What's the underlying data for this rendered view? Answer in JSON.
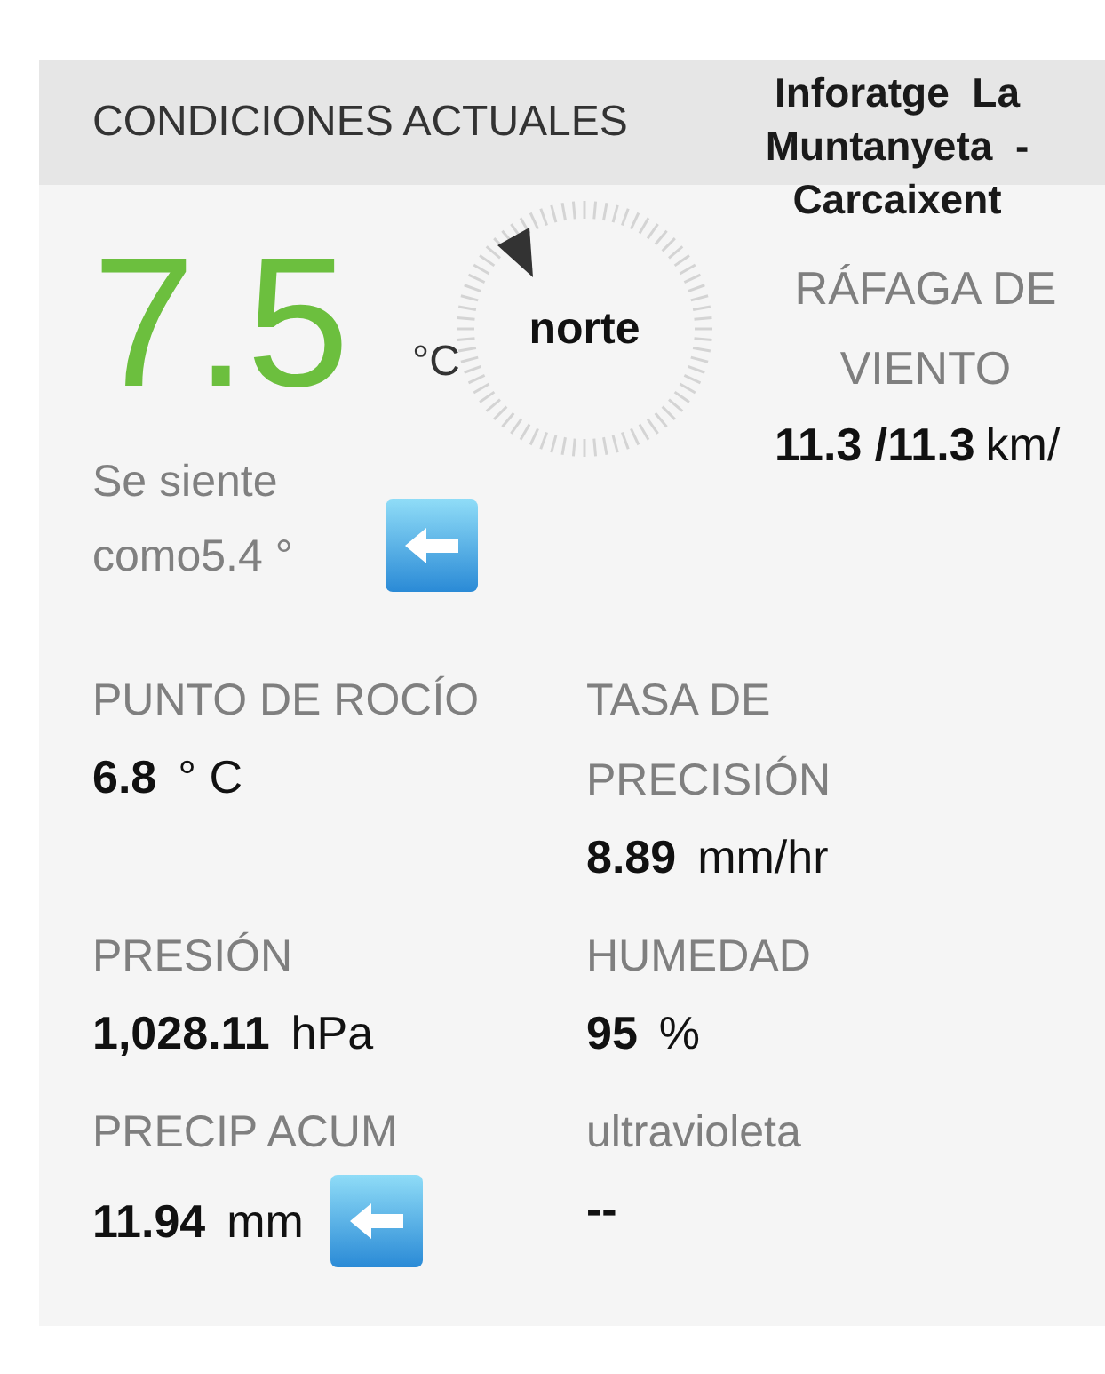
{
  "header": {
    "title": "CONDICIONES ACTUALES",
    "station": "Inforatge  La Muntanyeta  - Carcaixent"
  },
  "temperature": {
    "value": "7.5",
    "unit": "°C",
    "feels_like": "Se siente como5.4 °",
    "trend_arrow": true
  },
  "wind": {
    "direction": "norte",
    "label": "RÁFAGA DE VIENTO",
    "value": "11.3 /11.3",
    "unit": "km/"
  },
  "readings": [
    {
      "label": "PUNTO DE ROCÍO",
      "value": "6.8",
      "unit": "° C"
    },
    {
      "label": "TASA DE PRECISIÓN",
      "value": "8.89",
      "unit": "mm/hr"
    },
    {
      "label": "PRESIÓN",
      "value": "1,028.11",
      "unit": "hPa"
    },
    {
      "label": "HUMEDAD",
      "value": "95",
      "unit": "%"
    },
    {
      "label": "PRECIP ACUM",
      "value": "11.94",
      "unit": "mm",
      "trend_arrow": true
    },
    {
      "label": "ultravioleta",
      "value": "--"
    }
  ]
}
